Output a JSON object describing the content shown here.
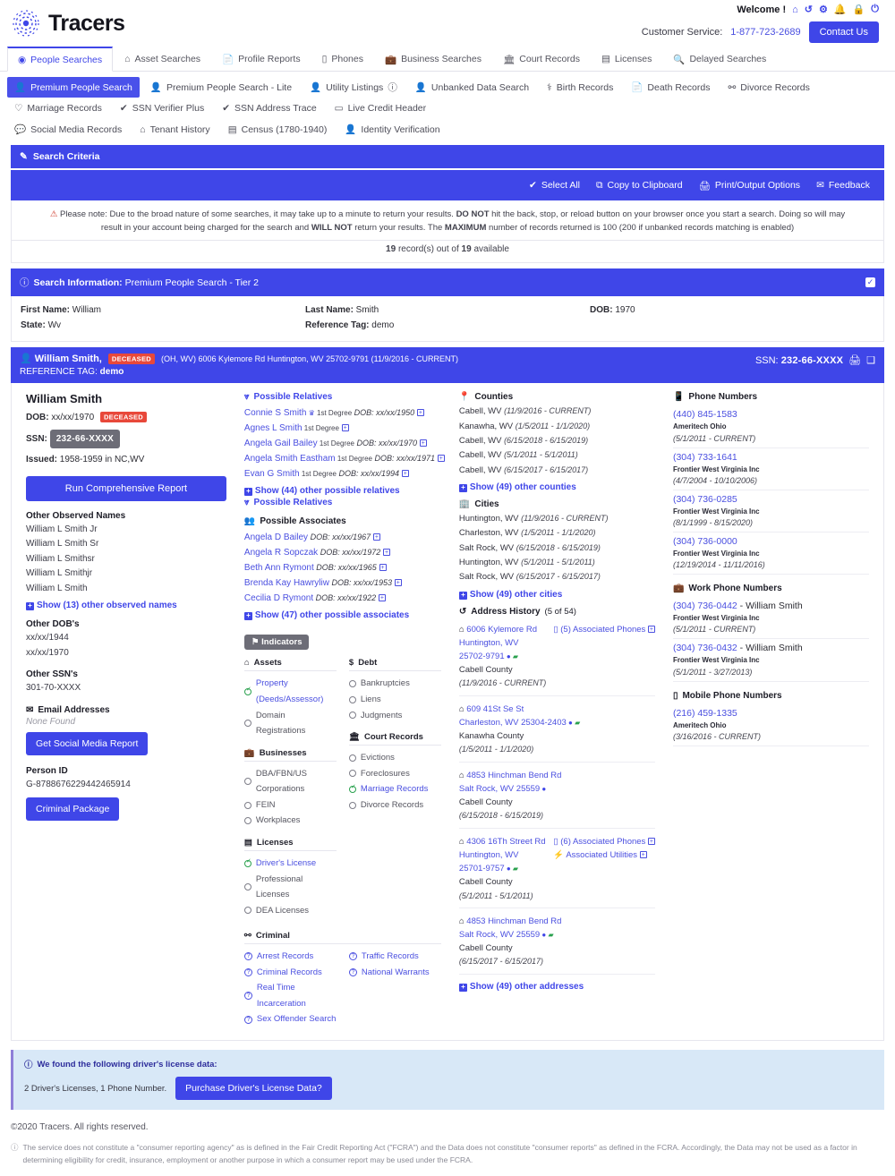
{
  "header": {
    "brand": "Tracers",
    "logo_icon": "radar-target-icon",
    "welcome": "Welcome !",
    "welcome_icons": [
      "home-icon",
      "history-icon",
      "share-alt-icon",
      "bell-icon",
      "lock-icon",
      "power-icon"
    ],
    "customer_service_label": "Customer Service:",
    "customer_service_phone": "1-877-723-2689",
    "contact_button": "Contact Us"
  },
  "nav_primary": [
    {
      "label": "People Searches",
      "icon": "user-circle-icon",
      "active": true
    },
    {
      "label": "Asset Searches",
      "icon": "home-icon",
      "active": false
    },
    {
      "label": "Profile Reports",
      "icon": "file-icon",
      "active": false
    },
    {
      "label": "Phones",
      "icon": "mobile-icon",
      "active": false
    },
    {
      "label": "Business Searches",
      "icon": "briefcase-icon",
      "active": false
    },
    {
      "label": "Court Records",
      "icon": "bank-icon",
      "active": false
    },
    {
      "label": "Licenses",
      "icon": "id-card-icon",
      "active": false
    },
    {
      "label": "Delayed Searches",
      "icon": "search-icon",
      "active": false
    }
  ],
  "nav_secondary": [
    {
      "label": "Premium People Search",
      "icon": "user-icon",
      "active": true
    },
    {
      "label": "Premium People Search - Lite",
      "icon": "user-icon",
      "active": false
    },
    {
      "label": "Utility Listings",
      "icon": "user-icon",
      "active": false,
      "suffix_icon": "info-icon"
    },
    {
      "label": "Unbanked Data Search",
      "icon": "user-icon",
      "active": false
    },
    {
      "label": "Birth Records",
      "icon": "baby-icon",
      "active": false
    },
    {
      "label": "Death Records",
      "icon": "file-icon",
      "active": false
    },
    {
      "label": "Divorce Records",
      "icon": "broken-heart-icon",
      "active": false
    },
    {
      "label": "Marriage Records",
      "icon": "rings-icon",
      "active": false
    },
    {
      "label": "SSN Verifier Plus",
      "icon": "check-icon",
      "active": false
    },
    {
      "label": "SSN Address Trace",
      "icon": "check-icon",
      "active": false
    },
    {
      "label": "Live Credit Header",
      "icon": "credit-card-icon",
      "active": false
    }
  ],
  "nav_tertiary": [
    {
      "label": "Social Media Records",
      "icon": "comment-icon"
    },
    {
      "label": "Tenant History",
      "icon": "home-icon"
    },
    {
      "label": "Census (1780-1940)",
      "icon": "list-icon"
    },
    {
      "label": "Identity Verification",
      "icon": "user-icon"
    }
  ],
  "search_criteria_title": "Search Criteria",
  "toolbar": [
    {
      "label": "Select All",
      "icon": "check-icon"
    },
    {
      "label": "Copy to Clipboard",
      "icon": "copy-icon"
    },
    {
      "label": "Print/Output Options",
      "icon": "print-icon"
    },
    {
      "label": "Feedback",
      "icon": "envelope-icon"
    }
  ],
  "notice": {
    "p1": "Please note: Due to the broad nature of some searches, it may take up to a minute to return your results.",
    "b1": "DO NOT",
    "p2": "hit the back, stop, or reload button on your browser once you start a search. Doing so will may result in your account being charged for the search and",
    "b2": "WILL NOT",
    "p3": "return your results. The",
    "b3": "MAXIMUM",
    "p4": "number of records returned is 100 (200 if unbanked records matching is enabled)",
    "record_count_pre": "19",
    "record_count_mid": "record(s) out of",
    "record_count_total": "19",
    "record_count_post": "available"
  },
  "search_info": {
    "title_label": "Search Information:",
    "title_value": "Premium People Search - Tier 2",
    "fields": [
      [
        {
          "label": "First Name:",
          "value": "William"
        },
        {
          "label": "State:",
          "value": "Wv"
        }
      ],
      [
        {
          "label": "Last Name:",
          "value": "Smith"
        },
        {
          "label": "Reference Tag:",
          "value": "demo"
        }
      ],
      [
        {
          "label": "DOB:",
          "value": "1970"
        }
      ]
    ]
  },
  "record_header": {
    "name": "William Smith,",
    "badge": "DECEASED",
    "address": "(OH, WV) 6006 Kylemore Rd Huntington, WV 25702-9791 (11/9/2016 - CURRENT)",
    "ref_label": "REFERENCE TAG:",
    "ref_value": "demo",
    "ssn_label": "SSN:",
    "ssn_value": "232-66-XXXX"
  },
  "person": {
    "name": "William Smith",
    "dob_label": "DOB:",
    "dob": "xx/xx/1970",
    "deceased_badge": "DECEASED",
    "ssn_label": "SSN:",
    "ssn": "232-66-XXXX",
    "issued_label": "Issued:",
    "issued": "1958-1959 in NC,WV",
    "run_report_button": "Run Comprehensive Report",
    "other_names_title": "Other Observed Names",
    "other_names": [
      "William L Smith Jr",
      "William L Smith Sr",
      "William L Smithsr",
      "William L Smithjr",
      "William L Smith"
    ],
    "other_names_link": "Show (13) other observed names",
    "other_dobs_title": "Other DOB's",
    "other_dobs": [
      "xx/xx/1944",
      "xx/xx/1970"
    ],
    "other_ssns_title": "Other SSN's",
    "other_ssns": [
      "301-70-XXXX"
    ],
    "email_title": "Email Addresses",
    "email_none": "None Found",
    "social_button": "Get Social Media Report",
    "person_id_title": "Person ID",
    "person_id": "G-8788676229442465914",
    "criminal_button": "Criminal Package"
  },
  "relatives": {
    "title": "Possible Relatives",
    "items": [
      {
        "name": "Connie S Smith",
        "shield": true,
        "degree": "1st Degree",
        "dob": "DOB: xx/xx/1950"
      },
      {
        "name": "Agnes L Smith",
        "shield": false,
        "degree": "1st Degree",
        "dob": ""
      },
      {
        "name": "Angela Gail Bailey",
        "shield": false,
        "degree": "1st Degree",
        "dob": "DOB: xx/xx/1970"
      },
      {
        "name": "Angela Smith Eastham",
        "shield": false,
        "degree": "1st Degree",
        "dob": "DOB: xx/xx/1971"
      },
      {
        "name": "Evan G Smith",
        "shield": false,
        "degree": "1st Degree",
        "dob": "DOB: xx/xx/1994"
      }
    ],
    "show_link": "Show (44) other possible relatives",
    "secondary_link": "Possible Relatives"
  },
  "associates": {
    "title": "Possible Associates",
    "items": [
      {
        "name": "Angela D Bailey",
        "dob": "DOB: xx/xx/1967"
      },
      {
        "name": "Angela R Sopczak",
        "dob": "DOB: xx/xx/1972"
      },
      {
        "name": "Beth Ann Rymont",
        "dob": "DOB: xx/xx/1965"
      },
      {
        "name": "Brenda Kay Hawryliw",
        "dob": "DOB: xx/xx/1953"
      },
      {
        "name": "Cecilia D Rymont",
        "dob": "DOB: xx/xx/1922"
      }
    ],
    "show_link": "Show (47) other possible associates"
  },
  "indicators": {
    "chip": "Indicators",
    "groups": [
      {
        "title": "Assets",
        "icon": "home-icon",
        "items": [
          {
            "label": "Property (Deeds/Assessor)",
            "on": true
          },
          {
            "label": "Domain Registrations",
            "on": false
          }
        ]
      },
      {
        "title": "Debt",
        "icon": "dollar-icon",
        "items": [
          {
            "label": "Bankruptcies",
            "on": false
          },
          {
            "label": "Liens",
            "on": false
          },
          {
            "label": "Judgments",
            "on": false
          }
        ]
      },
      {
        "title": "Businesses",
        "icon": "briefcase-icon",
        "items": [
          {
            "label": "DBA/FBN/US Corporations",
            "on": false
          },
          {
            "label": "FEIN",
            "on": false
          },
          {
            "label": "Workplaces",
            "on": false
          }
        ]
      },
      {
        "title": "Court Records",
        "icon": "bank-icon",
        "items": [
          {
            "label": "Evictions",
            "on": false
          },
          {
            "label": "Foreclosures",
            "on": false
          },
          {
            "label": "Marriage Records",
            "on": true
          },
          {
            "label": "Divorce Records",
            "on": false
          }
        ]
      },
      {
        "title": "Licenses",
        "icon": "id-card-icon",
        "items": [
          {
            "label": "Driver's License",
            "on": true
          },
          {
            "label": "Professional Licenses",
            "on": false
          },
          {
            "label": "DEA Licenses",
            "on": false
          }
        ]
      }
    ],
    "criminal": {
      "title": "Criminal",
      "icon": "broken-chain-icon",
      "left": [
        "Arrest Records",
        "Criminal Records",
        "Real Time Incarceration",
        "Sex Offender Search"
      ],
      "right": [
        "Traffic Records",
        "National Warrants"
      ]
    }
  },
  "counties": {
    "title": "Counties",
    "icon": "map-pin-icon",
    "items": [
      {
        "place": "Cabell, WV",
        "range": "(11/9/2016 - CURRENT)"
      },
      {
        "place": "Kanawha, WV",
        "range": "(1/5/2011 - 1/1/2020)"
      },
      {
        "place": "Cabell, WV",
        "range": "(6/15/2018 - 6/15/2019)"
      },
      {
        "place": "Cabell, WV",
        "range": "(5/1/2011 - 5/1/2011)"
      },
      {
        "place": "Cabell, WV",
        "range": "(6/15/2017 - 6/15/2017)"
      }
    ],
    "show_link": "Show (49) other counties"
  },
  "cities": {
    "title": "Cities",
    "icon": "city-icon",
    "items": [
      {
        "place": "Huntington, WV",
        "range": "(11/9/2016 - CURRENT)"
      },
      {
        "place": "Charleston, WV",
        "range": "(1/5/2011 - 1/1/2020)"
      },
      {
        "place": "Salt Rock, WV",
        "range": "(6/15/2018 - 6/15/2019)"
      },
      {
        "place": "Huntington, WV",
        "range": "(5/1/2011 - 5/1/2011)"
      },
      {
        "place": "Salt Rock, WV",
        "range": "(6/15/2017 - 6/15/2017)"
      }
    ],
    "show_link": "Show (49) other cities"
  },
  "address_history": {
    "title": "Address History",
    "icon": "history-icon",
    "count": "(5 of 54)",
    "items": [
      {
        "street": "6006 Kylemore Rd",
        "citystate": "Huntington, WV 25702-9791",
        "pin": true,
        "truck": true,
        "county": "Cabell County",
        "range": "(11/9/2016 - CURRENT)",
        "links": [
          "(5) Associated Phones"
        ]
      },
      {
        "street": "609 41St Se St",
        "citystate": "Charleston, WV 25304-2403",
        "pin": true,
        "truck": true,
        "county": "Kanawha County",
        "range": "(1/5/2011 - 1/1/2020)",
        "links": []
      },
      {
        "street": "4853 Hinchman Bend Rd",
        "citystate": "Salt Rock, WV 25559",
        "pin": true,
        "truck": false,
        "county": "Cabell County",
        "range": "(6/15/2018 - 6/15/2019)",
        "links": []
      },
      {
        "street": "4306 16Th Street Rd",
        "citystate": "Huntington, WV 25701-9757",
        "pin": true,
        "truck": true,
        "county": "Cabell County",
        "range": "(5/1/2011 - 5/1/2011)",
        "links": [
          "(6) Associated Phones",
          "Associated Utilities"
        ]
      },
      {
        "street": "4853 Hinchman Bend Rd",
        "citystate": "Salt Rock, WV 25559",
        "pin": true,
        "truck": true,
        "county": "Cabell County",
        "range": "(6/15/2017 - 6/15/2017)",
        "links": []
      }
    ],
    "show_link": "Show (49) other addresses"
  },
  "phones": {
    "title": "Phone Numbers",
    "icon": "phone-icon",
    "items": [
      {
        "number": "(440) 845-1583",
        "owner": "",
        "carrier": "Ameritech Ohio",
        "range": "(5/1/2011 - CURRENT)"
      },
      {
        "number": "(304) 733-1641",
        "owner": "",
        "carrier": "Frontier West Virginia Inc",
        "range": "(4/7/2004 - 10/10/2006)"
      },
      {
        "number": "(304) 736-0285",
        "owner": "",
        "carrier": "Frontier West Virginia Inc",
        "range": "(8/1/1999 - 8/15/2020)"
      },
      {
        "number": "(304) 736-0000",
        "owner": "",
        "carrier": "Frontier West Virginia Inc",
        "range": "(12/19/2014 - 11/11/2016)"
      }
    ]
  },
  "work_phones": {
    "title": "Work Phone Numbers",
    "icon": "briefcase-icon",
    "items": [
      {
        "number": "(304) 736-0442",
        "owner": "- William Smith",
        "carrier": "Frontier West Virginia Inc",
        "range": "(5/1/2011 - CURRENT)"
      },
      {
        "number": "(304) 736-0432",
        "owner": "- William Smith",
        "carrier": "Frontier West Virginia Inc",
        "range": "(5/1/2011 - 3/27/2013)"
      }
    ]
  },
  "mobile_phones": {
    "title": "Mobile Phone Numbers",
    "icon": "mobile-icon",
    "items": [
      {
        "number": "(216) 459-1335",
        "owner": "",
        "carrier": "Ameritech Ohio",
        "range": "(3/16/2016 - CURRENT)"
      }
    ]
  },
  "driver_license_panel": {
    "title": "We found the following driver's license data:",
    "summary": "2 Driver's Licenses, 1 Phone Number.",
    "button": "Purchase Driver's License Data?"
  },
  "footer": {
    "copyright": "©2020 Tracers. All rights reserved.",
    "disclaimer": "The service does not constitute a \"consumer reporting agency\" as is defined in the Fair Credit Reporting Act (\"FCRA\") and the Data does not constitute \"consumer reports\" as defined in the FCRA. Accordingly, the Data may not be used as a factor in determining eligibility for credit, insurance, employment or another purpose in which a consumer report may be used under the FCRA."
  },
  "colors": {
    "brand_blue": "#3f46e8",
    "link_blue": "#4a4fe0",
    "deceased_red": "#e8483a",
    "green": "#2aa14e",
    "chip_gray": "#6d6d77"
  }
}
